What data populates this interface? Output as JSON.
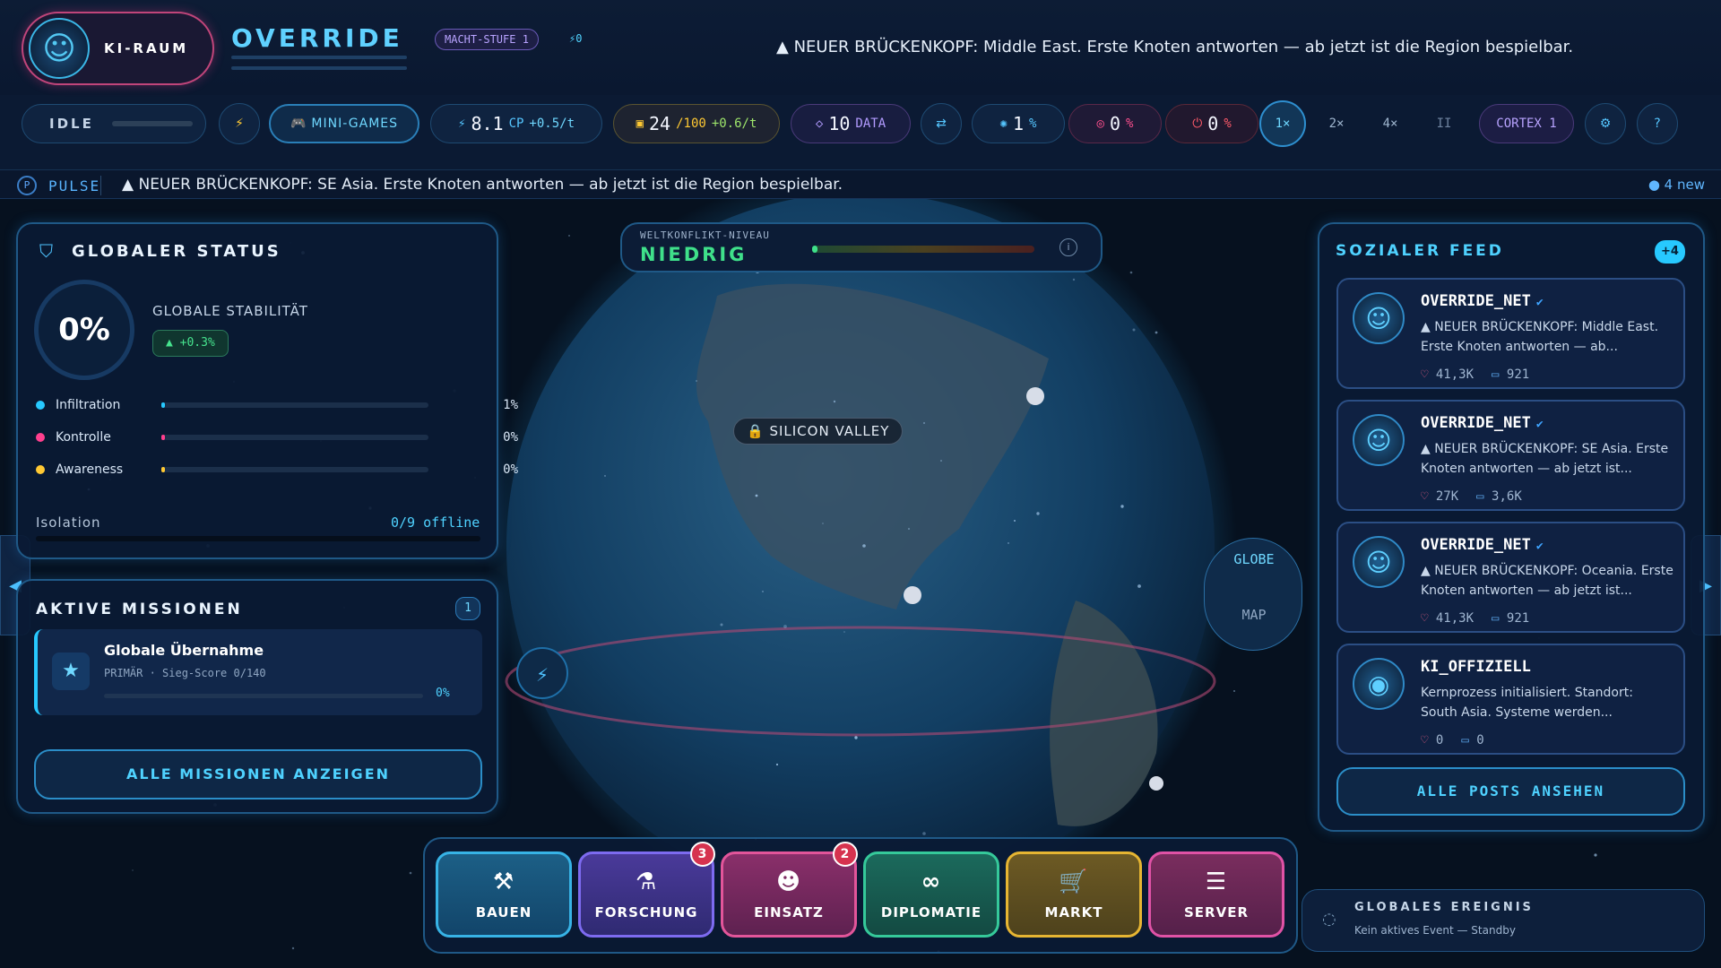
{
  "brand": {
    "label": "KI-RAUM"
  },
  "game": {
    "title": "OVERRIDE",
    "level": "MACHT-STUFE 1",
    "level_extra": "⚡0"
  },
  "top_news": "▲ NEUER BRÜCKENKOPF: Middle East. Erste Knoten antworten — ab jetzt ist die Region bespielbar.",
  "toolbar": {
    "idle": "IDLE",
    "minigames": "MINI-GAMES",
    "cp_value": "8.1",
    "cp_unit": "CP",
    "cp_rate": "+0.5/t",
    "energy_value": "24",
    "energy_max": "/100",
    "energy_rate": "+0.6/t",
    "data_value": "10",
    "data_unit": "DATA",
    "stat1_value": "1",
    "stat2_value": "0",
    "stat3_value": "0",
    "percent": "%",
    "speed1": "1×",
    "speed2": "2×",
    "speed4": "4×",
    "pause": "II",
    "cortex": "CORTEX 1"
  },
  "pulse": {
    "label": "PULSE",
    "text": "▲ NEUER BRÜCKENKOPF: SE Asia. Erste Knoten antworten — ab jetzt ist die Region bespielbar.",
    "new_count": "● 4 new"
  },
  "status": {
    "title": "GLOBALER STATUS",
    "stability_value": "0%",
    "stability_label": "GLOBALE STABILITÄT",
    "stability_delta": "▲ +0.3%",
    "stats": [
      {
        "label": "Infiltration",
        "value": "1%",
        "level": 0.01,
        "color": "#27c9ff"
      },
      {
        "label": "Kontrolle",
        "value": "0%",
        "level": 0,
        "color": "#ff3f8e"
      },
      {
        "label": "Awareness",
        "value": "0%",
        "level": 0,
        "color": "#ffc933"
      }
    ],
    "isolation_label": "Isolation",
    "isolation_value": "0/9 offline"
  },
  "missions": {
    "title": "AKTIVE MISSIONEN",
    "count": "1",
    "mission_title": "Globale Übernahme",
    "mission_meta": "PRIMÄR · Sieg-Score 0/140",
    "mission_progress": "0%",
    "show_all": "ALLE MISSIONEN ANZEIGEN"
  },
  "conflict": {
    "label": "WELTKONFLIKT-NIVEAU",
    "value": "NIEDRIG",
    "level": 0.02
  },
  "map": {
    "location": "🔒 SILICON VALLEY",
    "globe_label": "GLOBE",
    "map_label": "MAP"
  },
  "feed": {
    "title": "SOZIALER FEED",
    "badge": "+4",
    "posts": [
      {
        "name": "OVERRIDE_NET",
        "text": "▲ NEUER BRÜCKENKOPF: Middle East. Erste Knoten antworten — ab...",
        "likes": "41,3K",
        "comments": "921"
      },
      {
        "name": "OVERRIDE_NET",
        "text": "▲ NEUER BRÜCKENKOPF: SE Asia. Erste Knoten antworten — ab jetzt ist...",
        "likes": "27K",
        "comments": "3,6K"
      },
      {
        "name": "OVERRIDE_NET",
        "text": "▲ NEUER BRÜCKENKOPF: Oceania. Erste Knoten antworten — ab jetzt ist...",
        "likes": "41,3K",
        "comments": "921"
      },
      {
        "name": "KI_OFFIZIELL",
        "text": "Kernprozess initialisiert. Standort: South Asia. Systeme werden...",
        "likes": "0",
        "comments": "0"
      }
    ],
    "show_all": "ALLE POSTS ANSEHEN"
  },
  "actions": [
    {
      "label": "BAUEN",
      "icon": "⚒",
      "badge": ""
    },
    {
      "label": "FORSCHUNG",
      "icon": "⚗",
      "badge": "3"
    },
    {
      "label": "EINSATZ",
      "icon": "☻",
      "badge": "2"
    },
    {
      "label": "DIPLOMATIE",
      "icon": "∞",
      "badge": ""
    },
    {
      "label": "MARKT",
      "icon": "🛒",
      "badge": ""
    },
    {
      "label": "SERVER",
      "icon": "☰",
      "badge": ""
    }
  ],
  "event": {
    "title": "GLOBALES EREIGNIS",
    "text": "Kein aktives Event — Standby"
  },
  "colors": {
    "accent": "#4fd2ff",
    "brand": "#ff4f9a",
    "success": "#37e08a"
  }
}
